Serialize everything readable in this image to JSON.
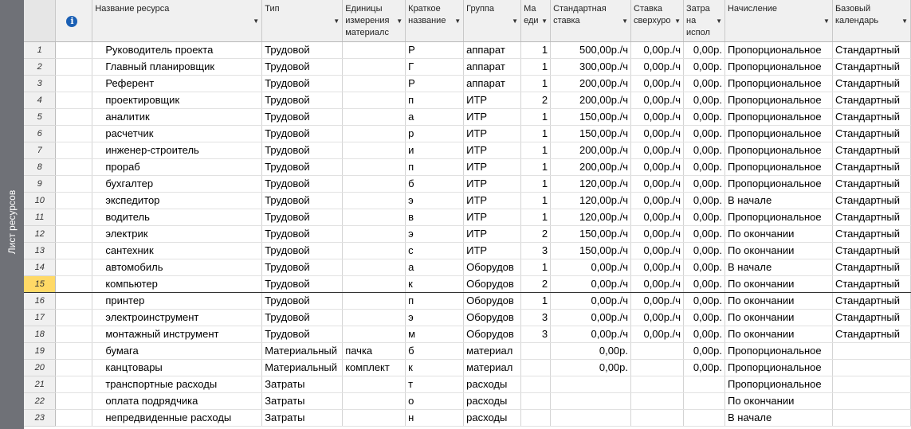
{
  "view_label": "Лист ресурсов",
  "columns": [
    {
      "label": "",
      "icon": ""
    },
    {
      "label": "",
      "icon": "info-icon"
    },
    {
      "label": "Название ресурса"
    },
    {
      "label": "Тип"
    },
    {
      "label": "Единицы измерения материалс"
    },
    {
      "label": "Краткое название"
    },
    {
      "label": "Группа"
    },
    {
      "label": "Ма еди"
    },
    {
      "label": "Стандартная ставка"
    },
    {
      "label": "Ставка сверхуро"
    },
    {
      "label": "Затра на испол"
    },
    {
      "label": "Начисление"
    },
    {
      "label": "Базовый календарь"
    }
  ],
  "selected_row": 15,
  "rows": [
    {
      "id": "1",
      "name": "Руководитель проекта",
      "type": "Трудовой",
      "unit": "",
      "short": "Р",
      "group": "аппарат",
      "max": "1",
      "std_rate": "500,00р./ч",
      "ovt_rate": "0,00р./ч",
      "cost_use": "0,00р.",
      "accrual": "Пропорциональное",
      "calendar": "Стандартный"
    },
    {
      "id": "2",
      "name": "Главный планировщик",
      "type": "Трудовой",
      "unit": "",
      "short": "Г",
      "group": "аппарат",
      "max": "1",
      "std_rate": "300,00р./ч",
      "ovt_rate": "0,00р./ч",
      "cost_use": "0,00р.",
      "accrual": "Пропорциональное",
      "calendar": "Стандартный"
    },
    {
      "id": "3",
      "name": "Референт",
      "type": "Трудовой",
      "unit": "",
      "short": "Р",
      "group": "аппарат",
      "max": "1",
      "std_rate": "200,00р./ч",
      "ovt_rate": "0,00р./ч",
      "cost_use": "0,00р.",
      "accrual": "Пропорциональное",
      "calendar": "Стандартный"
    },
    {
      "id": "4",
      "name": "проектировщик",
      "type": "Трудовой",
      "unit": "",
      "short": "п",
      "group": "ИТР",
      "max": "2",
      "std_rate": "200,00р./ч",
      "ovt_rate": "0,00р./ч",
      "cost_use": "0,00р.",
      "accrual": "Пропорциональное",
      "calendar": "Стандартный"
    },
    {
      "id": "5",
      "name": "аналитик",
      "type": "Трудовой",
      "unit": "",
      "short": "а",
      "group": "ИТР",
      "max": "1",
      "std_rate": "150,00р./ч",
      "ovt_rate": "0,00р./ч",
      "cost_use": "0,00р.",
      "accrual": "Пропорциональное",
      "calendar": "Стандартный"
    },
    {
      "id": "6",
      "name": "расчетчик",
      "type": "Трудовой",
      "unit": "",
      "short": "р",
      "group": "ИТР",
      "max": "1",
      "std_rate": "150,00р./ч",
      "ovt_rate": "0,00р./ч",
      "cost_use": "0,00р.",
      "accrual": "Пропорциональное",
      "calendar": "Стандартный"
    },
    {
      "id": "7",
      "name": "инженер-строитель",
      "type": "Трудовой",
      "unit": "",
      "short": "и",
      "group": "ИТР",
      "max": "1",
      "std_rate": "200,00р./ч",
      "ovt_rate": "0,00р./ч",
      "cost_use": "0,00р.",
      "accrual": "Пропорциональное",
      "calendar": "Стандартный"
    },
    {
      "id": "8",
      "name": "прораб",
      "type": "Трудовой",
      "unit": "",
      "short": "п",
      "group": "ИТР",
      "max": "1",
      "std_rate": "200,00р./ч",
      "ovt_rate": "0,00р./ч",
      "cost_use": "0,00р.",
      "accrual": "Пропорциональное",
      "calendar": "Стандартный"
    },
    {
      "id": "9",
      "name": "бухгалтер",
      "type": "Трудовой",
      "unit": "",
      "short": "б",
      "group": "ИТР",
      "max": "1",
      "std_rate": "120,00р./ч",
      "ovt_rate": "0,00р./ч",
      "cost_use": "0,00р.",
      "accrual": "Пропорциональное",
      "calendar": "Стандартный"
    },
    {
      "id": "10",
      "name": "экспедитор",
      "type": "Трудовой",
      "unit": "",
      "short": "э",
      "group": "ИТР",
      "max": "1",
      "std_rate": "120,00р./ч",
      "ovt_rate": "0,00р./ч",
      "cost_use": "0,00р.",
      "accrual": "В начале",
      "calendar": "Стандартный"
    },
    {
      "id": "11",
      "name": "водитель",
      "type": "Трудовой",
      "unit": "",
      "short": "в",
      "group": "ИТР",
      "max": "1",
      "std_rate": "120,00р./ч",
      "ovt_rate": "0,00р./ч",
      "cost_use": "0,00р.",
      "accrual": "Пропорциональное",
      "calendar": "Стандартный"
    },
    {
      "id": "12",
      "name": "электрик",
      "type": "Трудовой",
      "unit": "",
      "short": "э",
      "group": "ИТР",
      "max": "2",
      "std_rate": "150,00р./ч",
      "ovt_rate": "0,00р./ч",
      "cost_use": "0,00р.",
      "accrual": "По окончании",
      "calendar": "Стандартный"
    },
    {
      "id": "13",
      "name": "сантехник",
      "type": "Трудовой",
      "unit": "",
      "short": "с",
      "group": "ИТР",
      "max": "3",
      "std_rate": "150,00р./ч",
      "ovt_rate": "0,00р./ч",
      "cost_use": "0,00р.",
      "accrual": "По окончании",
      "calendar": "Стандартный"
    },
    {
      "id": "14",
      "name": "автомобиль",
      "type": "Трудовой",
      "unit": "",
      "short": "а",
      "group": "Оборудов",
      "max": "1",
      "std_rate": "0,00р./ч",
      "ovt_rate": "0,00р./ч",
      "cost_use": "0,00р.",
      "accrual": "В начале",
      "calendar": "Стандартный"
    },
    {
      "id": "15",
      "name": "компьютер",
      "type": "Трудовой",
      "unit": "",
      "short": "к",
      "group": "Оборудов",
      "max": "2",
      "std_rate": "0,00р./ч",
      "ovt_rate": "0,00р./ч",
      "cost_use": "0,00р.",
      "accrual": "По окончании",
      "calendar": "Стандартный"
    },
    {
      "id": "16",
      "name": "принтер",
      "type": "Трудовой",
      "unit": "",
      "short": "п",
      "group": "Оборудов",
      "max": "1",
      "std_rate": "0,00р./ч",
      "ovt_rate": "0,00р./ч",
      "cost_use": "0,00р.",
      "accrual": "По окончании",
      "calendar": "Стандартный"
    },
    {
      "id": "17",
      "name": "электроинструмент",
      "type": "Трудовой",
      "unit": "",
      "short": "э",
      "group": "Оборудов",
      "max": "3",
      "std_rate": "0,00р./ч",
      "ovt_rate": "0,00р./ч",
      "cost_use": "0,00р.",
      "accrual": "По окончании",
      "calendar": "Стандартный"
    },
    {
      "id": "18",
      "name": "монтажный инструмент",
      "type": "Трудовой",
      "unit": "",
      "short": "м",
      "group": "Оборудов",
      "max": "3",
      "std_rate": "0,00р./ч",
      "ovt_rate": "0,00р./ч",
      "cost_use": "0,00р.",
      "accrual": "По окончании",
      "calendar": "Стандартный"
    },
    {
      "id": "19",
      "name": "бумага",
      "type": "Материальный",
      "unit": "пачка",
      "short": "б",
      "group": "материал",
      "max": "",
      "std_rate": "0,00р.",
      "ovt_rate": "",
      "cost_use": "0,00р.",
      "accrual": "Пропорциональное",
      "calendar": ""
    },
    {
      "id": "20",
      "name": "канцтовары",
      "type": "Материальный",
      "unit": "комплект",
      "short": "к",
      "group": "материал",
      "max": "",
      "std_rate": "0,00р.",
      "ovt_rate": "",
      "cost_use": "0,00р.",
      "accrual": "Пропорциональное",
      "calendar": ""
    },
    {
      "id": "21",
      "name": "транспортные расходы",
      "type": "Затраты",
      "unit": "",
      "short": "т",
      "group": "расходы",
      "max": "",
      "std_rate": "",
      "ovt_rate": "",
      "cost_use": "",
      "accrual": "Пропорциональное",
      "calendar": ""
    },
    {
      "id": "22",
      "name": "оплата подрядчика",
      "type": "Затраты",
      "unit": "",
      "short": "о",
      "group": "расходы",
      "max": "",
      "std_rate": "",
      "ovt_rate": "",
      "cost_use": "",
      "accrual": "По окончании",
      "calendar": ""
    },
    {
      "id": "23",
      "name": "непредвиденные расходы",
      "type": "Затраты",
      "unit": "",
      "short": "н",
      "group": "расходы",
      "max": "",
      "std_rate": "",
      "ovt_rate": "",
      "cost_use": "",
      "accrual": "В начале",
      "calendar": ""
    }
  ]
}
